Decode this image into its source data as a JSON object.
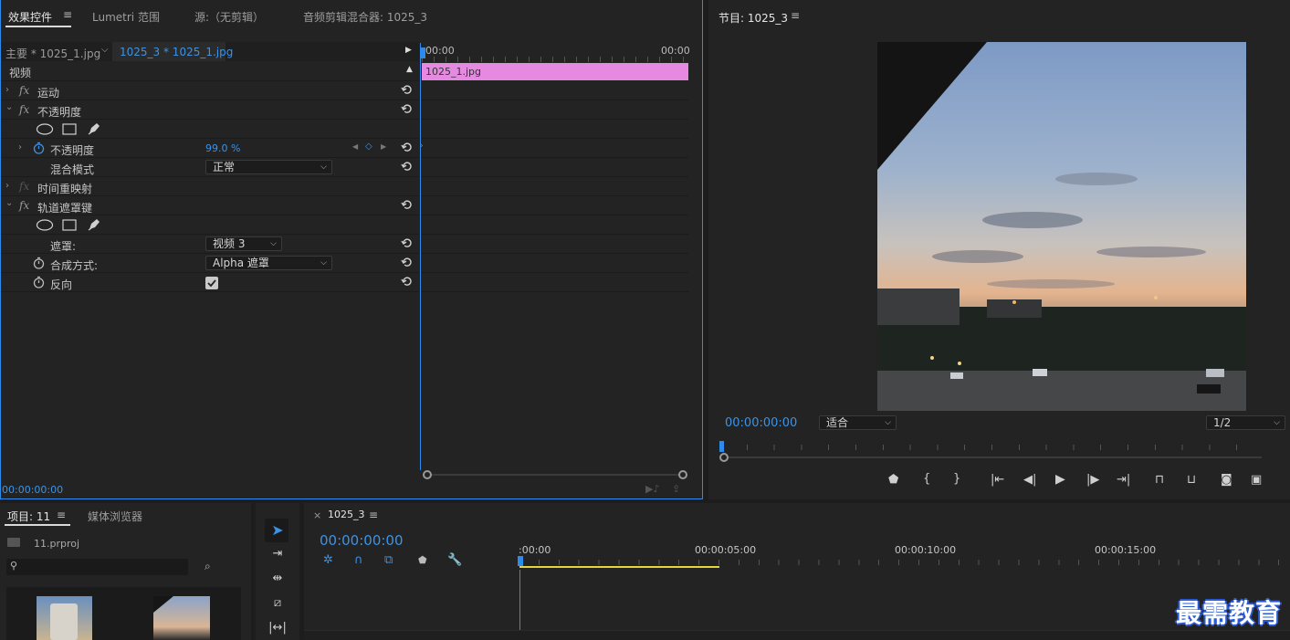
{
  "effect_panel": {
    "tabs": [
      "效果控件",
      "Lumetri 范围",
      "源:（无剪辑）",
      "音频剪辑混合器: 1025_3"
    ],
    "master_label": "主要 * 1025_1.jpg",
    "clip_label": "1025_3 * 1025_1.jpg",
    "video_header": "视频",
    "props": {
      "motion": "运动",
      "opacity_group": "不透明度",
      "opacity": "不透明度",
      "opacity_value": "99.0 %",
      "blend_mode": "混合模式",
      "blend_value": "正常",
      "time_remap": "时间重映射",
      "track_matte": "轨道遮罩键",
      "matte": "遮罩:",
      "matte_value": "视频 3",
      "composite": "合成方式:",
      "composite_value": "Alpha 遮罩",
      "reverse": "反向"
    },
    "fx_label": "fx",
    "timeline_start": "00:00",
    "timeline_end": "00:00",
    "clip_name": "1025_1.jpg",
    "timecode": "00:00:00:00",
    "clip_color": "#e58ae0"
  },
  "program_monitor": {
    "title": "节目: 1025_3",
    "timecode": "00:00:00:00",
    "fit": "适合",
    "resolution": "1/2"
  },
  "project_panel": {
    "tabs": [
      "项目: 11",
      "媒体浏览器"
    ],
    "project_file": "11.prproj"
  },
  "timeline": {
    "title": "1025_3",
    "close": "×",
    "timecode": "00:00:00:00",
    "ruler": [
      ":00:00",
      "00:00:05:00",
      "00:00:10:00",
      "00:00:15:00"
    ]
  },
  "watermark": "最需教育",
  "accent_color": "#2d8ceb"
}
